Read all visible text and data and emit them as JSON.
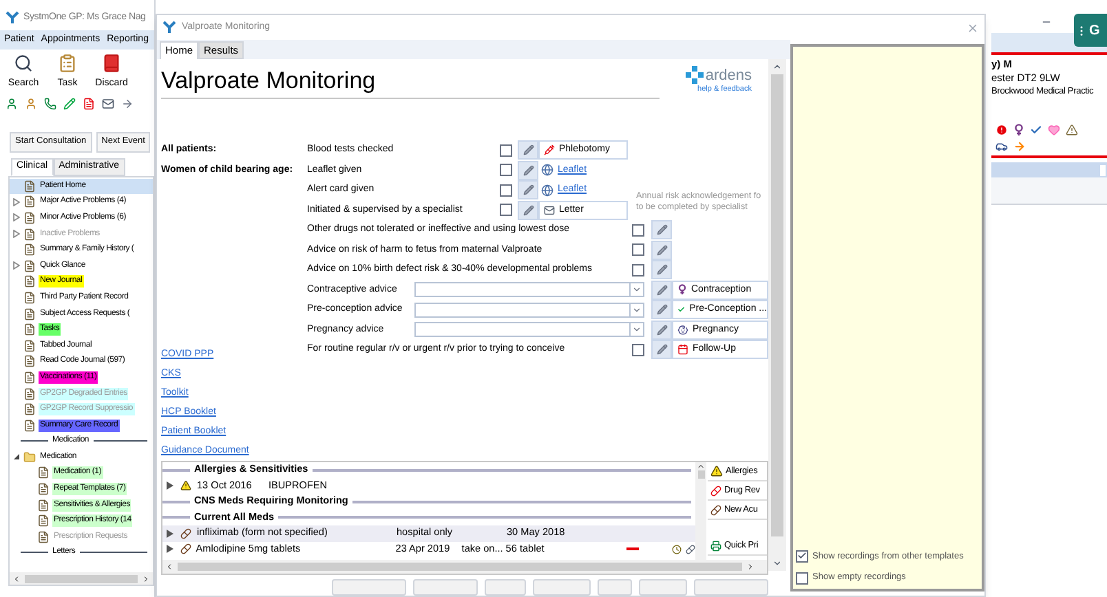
{
  "app": {
    "title": "SystmOne GP: Ms Grace Nag",
    "menu": [
      "Patient",
      "Appointments",
      "Reporting"
    ],
    "toolbar": [
      {
        "label": "Search",
        "kind": "search"
      },
      {
        "label": "Task",
        "kind": "task"
      },
      {
        "label": "Discard",
        "kind": "discard"
      }
    ],
    "buttons": [
      "Start Consultation",
      "Next Event"
    ],
    "tabs": [
      {
        "label": "Clinical",
        "selected": true
      },
      {
        "label": "Administrative",
        "selected": false
      }
    ],
    "tree": [
      {
        "kind": "item",
        "label": "Patient Home",
        "selected": true,
        "disabled": false
      },
      {
        "kind": "item",
        "label": "Major Active Problems (4)",
        "selected": false,
        "disabled": false,
        "expanded": false
      },
      {
        "kind": "item",
        "label": "Minor Active Problems (6)",
        "selected": false,
        "disabled": false,
        "expanded": false
      },
      {
        "kind": "item",
        "label": "Inactive Problems",
        "selected": false,
        "disabled": true,
        "expanded": false
      },
      {
        "kind": "item",
        "label": "Summary & Family History (",
        "selected": false,
        "disabled": false
      },
      {
        "kind": "item",
        "label": "Quick Glance",
        "selected": false,
        "disabled": false,
        "expanded": false
      },
      {
        "kind": "item",
        "label": "New Journal",
        "selected": false,
        "disabled": false,
        "color": "#ffff00"
      },
      {
        "kind": "item",
        "label": "Third Party Patient Record",
        "selected": false,
        "disabled": false
      },
      {
        "kind": "item",
        "label": "Subject Access Requests (",
        "selected": false,
        "disabled": false
      },
      {
        "kind": "item",
        "label": "Tasks",
        "selected": false,
        "disabled": false,
        "color": "#66ff66"
      },
      {
        "kind": "item",
        "label": "Tabbed Journal",
        "selected": false,
        "disabled": false
      },
      {
        "kind": "item",
        "label": "Read Code Journal (597)",
        "selected": false,
        "disabled": false
      },
      {
        "kind": "item",
        "label": "Vaccinations (11)",
        "selected": false,
        "disabled": false,
        "color": "#ff00cc"
      },
      {
        "kind": "item",
        "label": "GP2GP Degraded Entries",
        "selected": false,
        "disabled": true,
        "color": "#ccffff"
      },
      {
        "kind": "item",
        "label": "GP2GP Record Suppressio",
        "selected": false,
        "disabled": true,
        "color": "#ccffff"
      },
      {
        "kind": "item",
        "label": "Summary Care Record",
        "selected": false,
        "disabled": false,
        "color": "#6666ff"
      },
      {
        "kind": "separator",
        "label": "Medication"
      },
      {
        "kind": "item",
        "label": "Medication",
        "selected": false,
        "disabled": false,
        "expanded": true,
        "children": [
          {
            "kind": "item",
            "label": "Medication (1)",
            "selected": false,
            "disabled": false,
            "color": "#ccffcc"
          },
          {
            "kind": "item",
            "label": "Repeat Templates (7)",
            "selected": false,
            "disabled": false,
            "color": "#ccffcc"
          },
          {
            "kind": "item",
            "label": "Sensitivities & Allergies",
            "selected": false,
            "disabled": false,
            "color": "#ccffcc"
          },
          {
            "kind": "item",
            "label": "Prescription History (14",
            "selected": false,
            "disabled": false,
            "color": "#ccffcc"
          },
          {
            "kind": "item",
            "label": "Prescription Requests",
            "selected": false,
            "disabled": true
          }
        ]
      },
      {
        "kind": "separator",
        "label": "Letters"
      }
    ],
    "patient": {
      "name": "y) M",
      "address": "ester DT2 9LW",
      "practice": "Brockwood Medical Practic"
    },
    "side_button": "G"
  },
  "dialog": {
    "title": "Valproate Monitoring",
    "tabs": [
      {
        "label": "Home",
        "selected": true
      },
      {
        "label": "Results",
        "selected": false
      }
    ],
    "heading": "Valproate Monitoring",
    "logo": {
      "name": "ardens",
      "link": "help & feedback"
    },
    "groups": [
      "All patients:",
      "Women of child bearing age:"
    ],
    "note": [
      "Annual risk acknowledgement fo",
      "to be completed by specialist"
    ],
    "rows": [
      {
        "kind": "check",
        "label": "Blood tests checked",
        "checked": false,
        "action": {
          "kind": "button",
          "label": "Phlebotomy"
        }
      },
      {
        "kind": "check",
        "label": "Leaflet given",
        "checked": false,
        "action": {
          "kind": "link",
          "label": "Leaflet"
        }
      },
      {
        "kind": "check",
        "label": "Alert card given",
        "checked": false,
        "action": {
          "kind": "link",
          "label": "Leaflet"
        }
      },
      {
        "kind": "check",
        "label": "Initiated & supervised by a specialist",
        "checked": false,
        "action": {
          "kind": "button",
          "label": "Letter"
        }
      },
      {
        "kind": "wide",
        "label": "Other drugs not tolerated or ineffective and using lowest dose",
        "checked": false
      },
      {
        "kind": "wide",
        "label": "Advice on risk of harm to fetus from maternal Valproate",
        "checked": false
      },
      {
        "kind": "wide",
        "label": "Advice on 10% birth defect risk & 30-40% developmental problems",
        "checked": false
      },
      {
        "kind": "select",
        "label": "Contraceptive advice",
        "action": {
          "kind": "button",
          "label": "Contraception"
        }
      },
      {
        "kind": "select",
        "label": "Pre-conception advice",
        "action": {
          "kind": "button",
          "label": "Pre-Conception ..."
        }
      },
      {
        "kind": "select",
        "label": "Pregnancy advice",
        "action": {
          "kind": "button",
          "label": "Pregnancy"
        }
      },
      {
        "kind": "wide",
        "label": "For routine regular r/v or urgent r/v prior to trying to conceive",
        "checked": false,
        "action": {
          "kind": "button",
          "label": "Follow-Up"
        }
      }
    ],
    "links": [
      "COVID PPP",
      "CKS",
      "Toolkit",
      "HCP Booklet",
      "Patient Booklet",
      "Guidance Document"
    ],
    "medlist": {
      "sections": [
        {
          "title": "Allergies & Sensitivities",
          "rows": [
            {
              "kind": "allergy",
              "cells": [
                "13 Oct 2016",
                "IBUPROFEN"
              ]
            }
          ]
        },
        {
          "title": "CNS Meds Requiring Monitoring"
        },
        {
          "title": "Current All Meds",
          "rows": [
            {
              "kind": "hospital",
              "cells": [
                "infliximab (form not specified)",
                "hospital only",
                "",
                "30 May 2018"
              ]
            },
            {
              "kind": "repeat",
              "cells": [
                "Amlodipine 5mg tablets",
                "23 Apr 2019",
                "take on...",
                "56 tablet"
              ]
            }
          ]
        }
      ],
      "side_buttons": [
        "Allergies",
        "Drug Rev",
        "New Acu",
        "Quick Pri"
      ]
    },
    "options": [
      {
        "label": "Show recordings from other templates",
        "checked": true
      },
      {
        "label": "Show empty recordings",
        "checked": false
      }
    ]
  }
}
